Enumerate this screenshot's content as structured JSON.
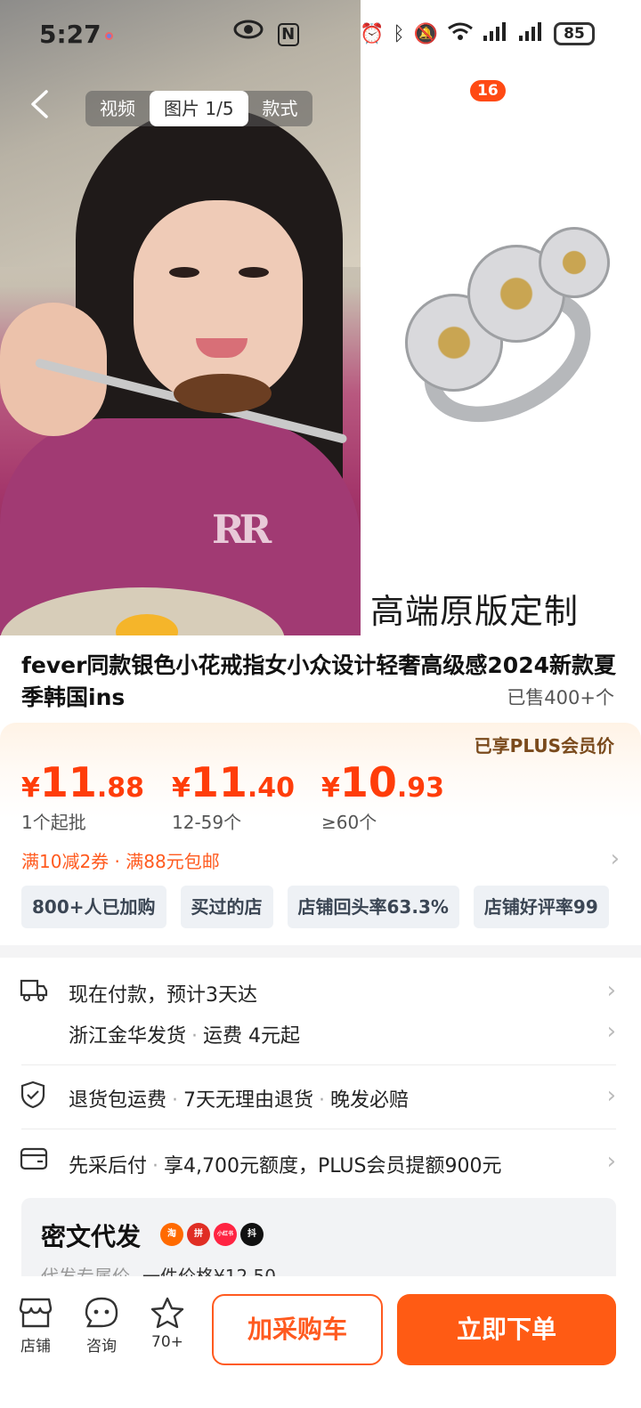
{
  "status_bar": {
    "time": "5:27",
    "nfc": "N",
    "battery": "85"
  },
  "nav": {
    "tabs": [
      "视频",
      "图片 1/5",
      "款式"
    ],
    "active_tab": 1,
    "cart_count": "16"
  },
  "hero": {
    "photo_logo": "RR",
    "product_caption": "高端原版定制"
  },
  "product": {
    "title": "fever同款银色小花戒指女小众设计轻奢高级感2024新款夏季韩国ins",
    "sold": "已售400+个"
  },
  "pricing": {
    "plus_label": "已享PLUS会员价",
    "tiers": [
      {
        "currency": "¥",
        "int": "11",
        "dec": ".88",
        "qty": "1个起批"
      },
      {
        "currency": "¥",
        "int": "11",
        "dec": ".40",
        "qty": "12-59个"
      },
      {
        "currency": "¥",
        "int": "10",
        "dec": ".93",
        "qty": "≥60个"
      }
    ],
    "promo": "满10减2券 · 满88元包邮",
    "chips": [
      "800+人已加购",
      "买过的店",
      "店铺回头率63.3%",
      "店铺好评率99"
    ]
  },
  "services": {
    "delivery": "现在付款，预计3天达",
    "ship_from": "浙江金华发货",
    "shipping_fee": "运费 4元起",
    "returns": [
      "退货包运费",
      "7天无理由退货",
      "晚发必赔"
    ],
    "pay_later": "先采后付",
    "credit": "享4,700元额度，PLUS会员提额900元"
  },
  "dropship": {
    "title": "密文代发",
    "platforms": [
      "淘",
      "拼",
      "小红书",
      "抖"
    ],
    "sub_label": "代发专属价",
    "sub_value": "一件价格¥12.50"
  },
  "bottom": {
    "store": "店铺",
    "consult": "咨询",
    "favorites": "70+",
    "add_cart": "加采购车",
    "buy_now": "立即下单"
  },
  "colors": {
    "accent": "#ff5b14",
    "price": "#ff3d0a",
    "badge": "#ff4a14"
  }
}
